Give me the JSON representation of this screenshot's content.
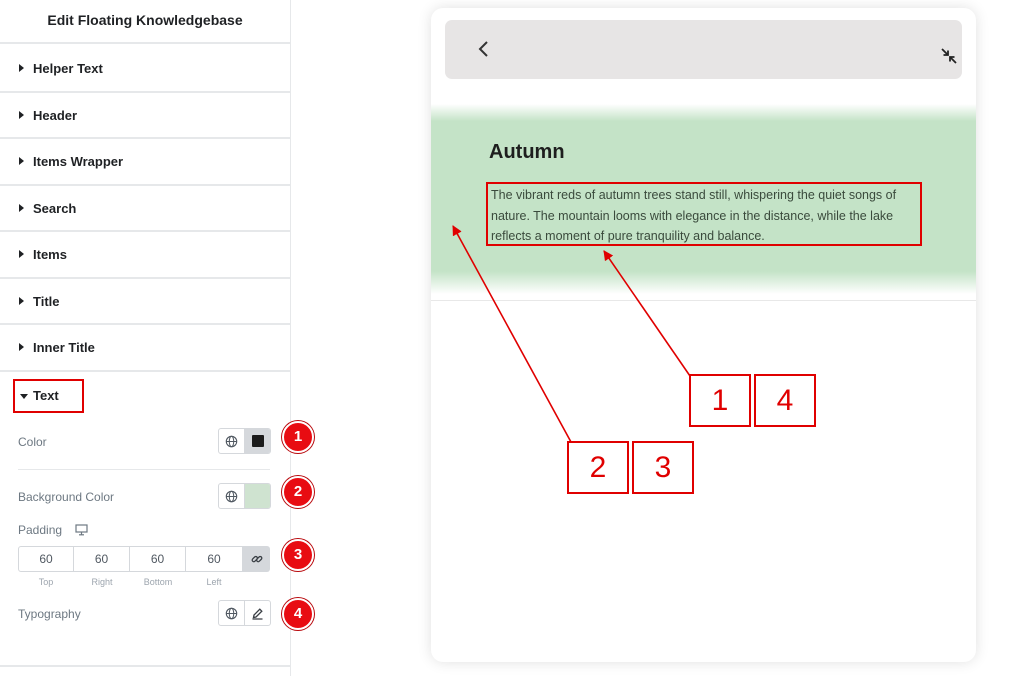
{
  "panel": {
    "title": "Edit Floating Knowledgebase",
    "sections": [
      "Helper Text",
      "Header",
      "Items Wrapper",
      "Search",
      "Items",
      "Title",
      "Inner Title"
    ],
    "open_section": "Text",
    "controls": {
      "color_label": "Color",
      "color_value": "#1b1b1b",
      "background_label": "Background Color",
      "background_value": "#cfe3d0",
      "padding_label": "Padding",
      "padding_values": [
        "60",
        "60",
        "60",
        "60"
      ],
      "padding_sides": [
        "Top",
        "Right",
        "Bottom",
        "Left"
      ],
      "typography_label": "Typography"
    },
    "badges": [
      "1",
      "2",
      "3",
      "4"
    ]
  },
  "preview": {
    "item_title": "Autumn",
    "item_text": "The vibrant reds of autumn trees stand still, whispering the quiet songs of nature. The mountain looms with elegance in the distance, while the lake reflects a moment of pure tranquility and balance.",
    "band_color": "#c4e3c7"
  },
  "annotations": {
    "box_labels": [
      "1",
      "4",
      "2",
      "3"
    ],
    "accent_color": "#e00000"
  }
}
